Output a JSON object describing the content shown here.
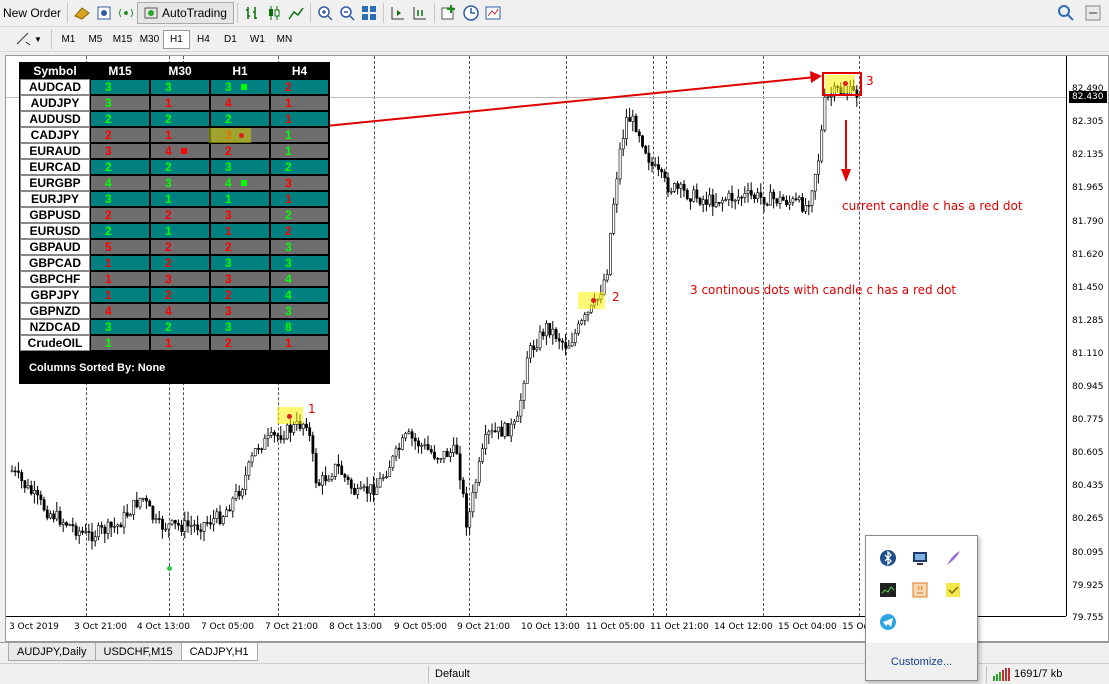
{
  "toolbar": {
    "new_order": "New Order",
    "autotrading": "AutoTrading"
  },
  "timeframes": [
    "M1",
    "M5",
    "M15",
    "M30",
    "H1",
    "H4",
    "D1",
    "W1",
    "MN"
  ],
  "active_timeframe": "H1",
  "chart": {
    "symbol": "CADJPY",
    "timeframe": "H1",
    "current_price": "82.430",
    "y_labels": [
      "82.490",
      "82.305",
      "82.135",
      "81.965",
      "81.790",
      "81.620",
      "81.450",
      "81.285",
      "81.110",
      "80.945",
      "80.775",
      "80.605",
      "80.435",
      "80.265",
      "80.095",
      "79.925",
      "79.755"
    ],
    "x_labels": [
      "3 Oct 2019",
      "3 Oct 21:00",
      "4 Oct 13:00",
      "7 Oct 05:00",
      "7 Oct 21:00",
      "8 Oct 13:00",
      "9 Oct 05:00",
      "9 Oct 21:00",
      "10 Oct 13:00",
      "11 Oct 05:00",
      "11 Oct 21:00",
      "14 Oct 12:00",
      "15 Oct 04:00",
      "15 Oc"
    ]
  },
  "dashboard": {
    "headers": [
      "Symbol",
      "M15",
      "M30",
      "H1",
      "H4"
    ],
    "rows": [
      {
        "symbol": "AUDCAD",
        "bg": "teal",
        "m15": "3",
        "m30": "3",
        "h1": "3",
        "h4": "2"
      },
      {
        "symbol": "AUDJPY",
        "bg": "gray",
        "m15": "3",
        "m30": "1",
        "h1": "4",
        "h4": "1"
      },
      {
        "symbol": "AUDUSD",
        "bg": "teal",
        "m15": "2",
        "m30": "2",
        "h1": "2",
        "h4": "1"
      },
      {
        "symbol": "CADJPY",
        "bg": "gray",
        "m15": "2",
        "m30": "1",
        "h1": "3",
        "h4": "1"
      },
      {
        "symbol": "EURAUD",
        "bg": "gray",
        "m15": "3",
        "m30": "4",
        "h1": "2",
        "h4": "1"
      },
      {
        "symbol": "EURCAD",
        "bg": "teal",
        "m15": "2",
        "m30": "2",
        "h1": "3",
        "h4": "2"
      },
      {
        "symbol": "EURGBP",
        "bg": "gray",
        "m15": "4",
        "m30": "3",
        "h1": "4",
        "h4": "3"
      },
      {
        "symbol": "EURJPY",
        "bg": "teal",
        "m15": "3",
        "m30": "1",
        "h1": "1",
        "h4": "1"
      },
      {
        "symbol": "GBPUSD",
        "bg": "gray",
        "m15": "2",
        "m30": "2",
        "h1": "3",
        "h4": "2"
      },
      {
        "symbol": "EURUSD",
        "bg": "teal",
        "m15": "2",
        "m30": "1",
        "h1": "1",
        "h4": "2"
      },
      {
        "symbol": "GBPAUD",
        "bg": "gray",
        "m15": "5",
        "m30": "2",
        "h1": "2",
        "h4": "3"
      },
      {
        "symbol": "GBPCAD",
        "bg": "teal",
        "m15": "1",
        "m30": "2",
        "h1": "3",
        "h4": "3"
      },
      {
        "symbol": "GBPCHF",
        "bg": "gray",
        "m15": "1",
        "m30": "3",
        "h1": "3",
        "h4": "4"
      },
      {
        "symbol": "GBPJPY",
        "bg": "teal",
        "m15": "1",
        "m30": "2",
        "h1": "2",
        "h4": "4"
      },
      {
        "symbol": "GBPNZD",
        "bg": "gray",
        "m15": "4",
        "m30": "4",
        "h1": "3",
        "h4": "3"
      },
      {
        "symbol": "NZDCAD",
        "bg": "teal",
        "m15": "3",
        "m30": "2",
        "h1": "3",
        "h4": "8"
      },
      {
        "symbol": "CrudeOIL",
        "bg": "gray",
        "m15": "1",
        "m30": "1",
        "h1": "2",
        "h4": "1"
      }
    ],
    "footer": "Columns Sorted By: None"
  },
  "annotations": {
    "label1": "1",
    "label2": "2",
    "label3": "3",
    "note1": "current candle c has a red dot",
    "note2": "3 continous dots with candle c has a red dot"
  },
  "tabs": [
    "AUDJPY,Daily",
    "USDCHF,M15",
    "CADJPY,H1"
  ],
  "active_tab": "CADJPY,H1",
  "status": {
    "profile": "Default",
    "traffic": "1691/7 kb"
  },
  "tray": {
    "customize": "Customize...",
    "icons": [
      "bluetooth-icon",
      "network-monitor-icon",
      "feather-icon",
      "terminal-icon",
      "java-icon",
      "sticky-note-icon",
      "telegram-icon"
    ]
  },
  "colors": {
    "teal": "#008080",
    "gray": "#6e6e6e",
    "green_value": "#00ff00",
    "red_value": "#ff0000",
    "annotation": "#e00000"
  }
}
